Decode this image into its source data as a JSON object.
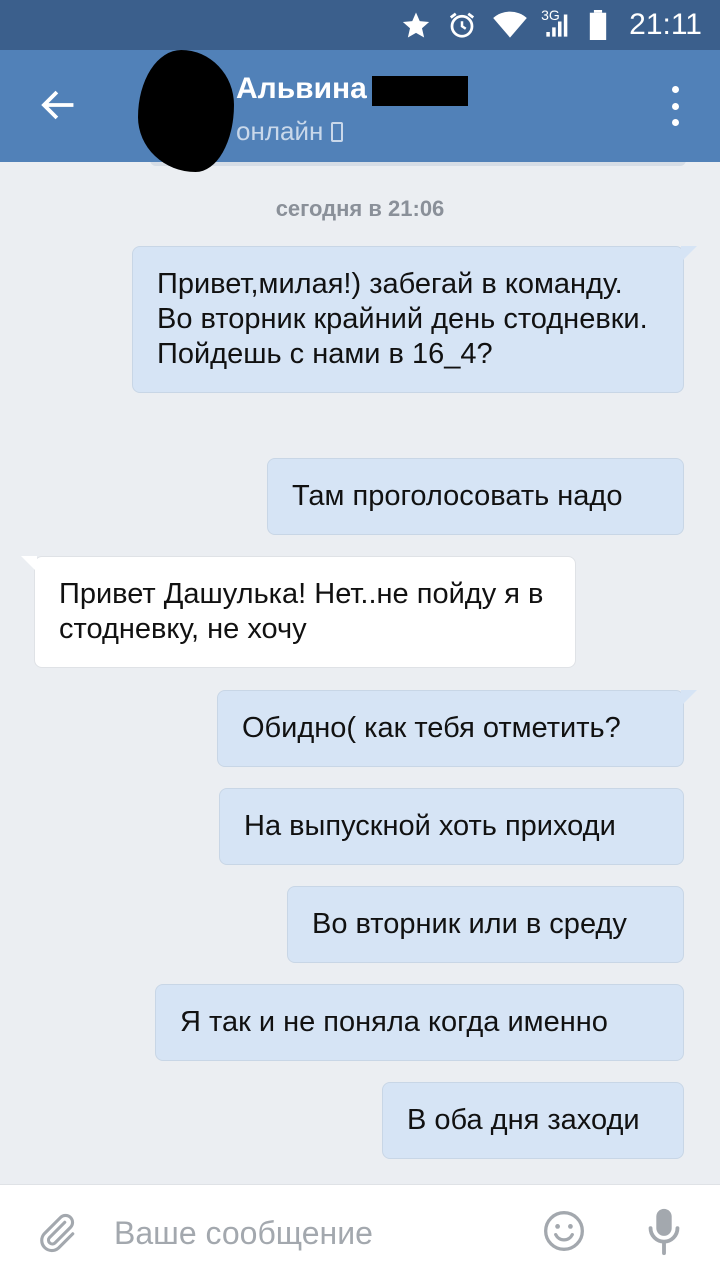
{
  "status_bar": {
    "time": "21:11",
    "network": "3G",
    "icons": [
      "star-icon",
      "alarm-icon",
      "wifi-icon",
      "signal-icon",
      "battery-icon"
    ]
  },
  "header": {
    "contact_name": "Альвина",
    "status": "онлайн",
    "accent_color": "#5181b8"
  },
  "conversation": {
    "date_separator": "сегодня в 21:06",
    "messages": [
      {
        "direction": "out",
        "text": "Привет,милая!) забегай в команду. Во вторник крайний день стодневки. Пойдешь с нами в 16_4?"
      },
      {
        "direction": "out",
        "text": "Там проголосовать надо"
      },
      {
        "direction": "in",
        "text": "Привет Дашулька! Нет..не пойду я в стодневку, не хочу"
      },
      {
        "direction": "out",
        "text": "Обидно( как тебя отметить?"
      },
      {
        "direction": "out",
        "text": "На выпускной хоть приходи"
      },
      {
        "direction": "out",
        "text": "Во вторник или в среду"
      },
      {
        "direction": "out",
        "text": "Я так и не поняла  когда именно"
      },
      {
        "direction": "out",
        "text": "В оба дня заходи"
      }
    ]
  },
  "composer": {
    "placeholder": "Ваше сообщение"
  }
}
